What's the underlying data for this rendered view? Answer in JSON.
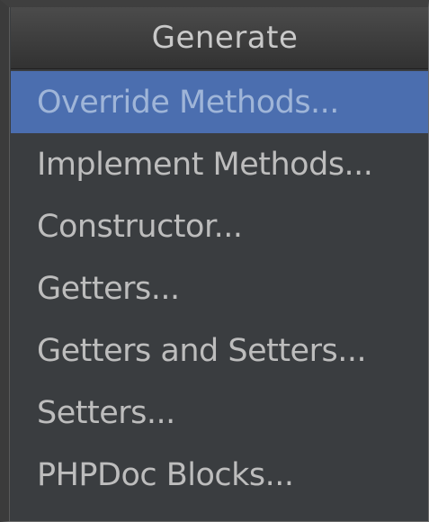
{
  "popup": {
    "title": "Generate",
    "selected_index": 0,
    "items": [
      {
        "label": "Override Methods..."
      },
      {
        "label": "Implement Methods..."
      },
      {
        "label": "Constructor..."
      },
      {
        "label": "Getters..."
      },
      {
        "label": "Getters and Setters..."
      },
      {
        "label": "Setters..."
      },
      {
        "label": "PHPDoc Blocks..."
      }
    ]
  },
  "colors": {
    "background": "#3a3d40",
    "selection": "#4b6eaf",
    "text": "#bdbdbd",
    "title_text": "#c9c9c9"
  }
}
